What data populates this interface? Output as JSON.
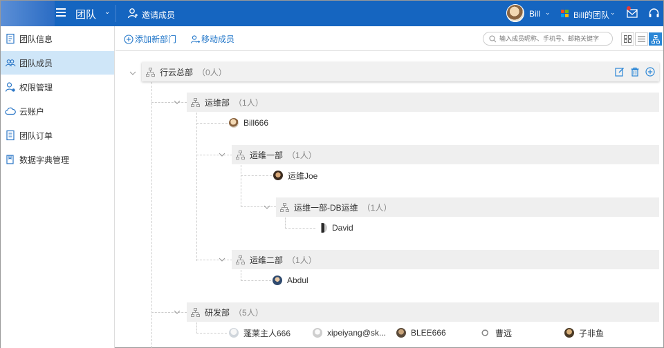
{
  "header": {
    "team_title": "团队",
    "invite_label": "邀请成员",
    "user_name": "Bill",
    "team_switch": "Bill的团队"
  },
  "sidebar": {
    "items": [
      {
        "label": "团队信息",
        "icon": "info-icon"
      },
      {
        "label": "团队成员",
        "icon": "members-icon",
        "active": true
      },
      {
        "label": "权限管理",
        "icon": "permission-icon"
      },
      {
        "label": "云账户",
        "icon": "cloud-icon"
      },
      {
        "label": "团队订单",
        "icon": "order-icon"
      },
      {
        "label": "数据字典管理",
        "icon": "dictionary-icon"
      }
    ]
  },
  "toolbar": {
    "add_dept": "添加新部门",
    "move_member": "移动成员",
    "search_placeholder": "输入成员昵称、手机号、邮箱关键字"
  },
  "tree": {
    "root": {
      "name": "行云总部",
      "count": "（0人）"
    },
    "depts": {
      "ops": {
        "name": "运维部",
        "count": "（1人）"
      },
      "ops1": {
        "name": "运维一部",
        "count": "（1人）"
      },
      "ops1db": {
        "name": "运维一部-DB运维",
        "count": "（1人）"
      },
      "ops2": {
        "name": "运维二部",
        "count": "（1人）"
      },
      "dev": {
        "name": "研发部",
        "count": "（5人）"
      }
    },
    "members": {
      "bill": "Bill666",
      "joe": "运维Joe",
      "david": "David",
      "abdul": "Abdul",
      "dev1": "蓬莱主人666",
      "dev2": "xipeiyang@sk...",
      "dev3": "BLEE666",
      "dev4": "曹远",
      "dev5": "子非鱼"
    }
  },
  "colors": {
    "header_bg": "#1565c0",
    "accent": "#1e74c8",
    "active_sidebar": "#cfe6f8"
  }
}
